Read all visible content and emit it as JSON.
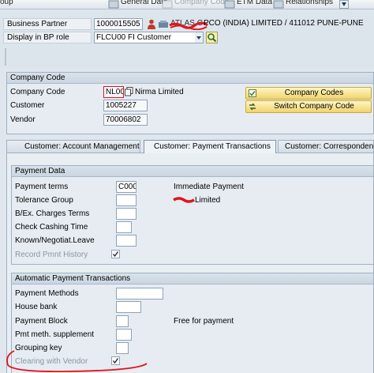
{
  "topbar": {
    "items": [
      "oup",
      "General Data",
      "Company Code",
      "ETM Data",
      "Relationships"
    ]
  },
  "header": {
    "business_partner_label": "Business Partner",
    "business_partner_value": "1000015505",
    "business_partner_desc": "PCO (INDIA) LIMITED / 411012 PUNE-PUNE",
    "bp_role_label": "Display in BP role",
    "bp_role_value": "FLCU00 FI Customer"
  },
  "company_code_box": {
    "title": "Company Code",
    "company_code_label": "Company Code",
    "company_code_value": "NL00",
    "company_name": "Nirma Limited",
    "customer_label": "Customer",
    "customer_value": "1005227",
    "vendor_label": "Vendor",
    "vendor_value": "70006802",
    "btn_company_codes": "Company Codes",
    "btn_switch_company_code": "Switch Company Code"
  },
  "tabs": [
    {
      "label": "Customer: Account Management",
      "active": false
    },
    {
      "label": "Customer: Payment Transactions",
      "active": true
    },
    {
      "label": "Customer: Correspondence",
      "active": false
    }
  ],
  "payment_data": {
    "title": "Payment Data",
    "payment_terms_label": "Payment terms",
    "payment_terms_value": "C000",
    "payment_terms_desc": "Immediate Payment",
    "tolerance_group_label": "Tolerance Group",
    "tolerance_group_desc": "Limited",
    "bex_charges_terms_label": "B/Ex. Charges Terms",
    "check_cashing_time_label": "Check Cashing Time",
    "known_negotiat_leave_label": "Known/Negotiat.Leave",
    "record_pmnt_history_label": "Record Pmnt History",
    "record_pmnt_history_checked": true
  },
  "auto_payment": {
    "title": "Automatic Payment Transactions",
    "payment_methods_label": "Payment Methods",
    "house_bank_label": "House bank",
    "payment_block_label": "Payment Block",
    "payment_block_desc": "Free for payment",
    "pmt_meth_supplement_label": "Pmt meth. supplement",
    "grouping_key_label": "Grouping key",
    "clearing_with_vendor_label": "Clearing with Vendor",
    "clearing_with_vendor_checked": true
  },
  "colors": {
    "annotation_red": "#e0141e",
    "button_yellow": "#f2d36b"
  }
}
